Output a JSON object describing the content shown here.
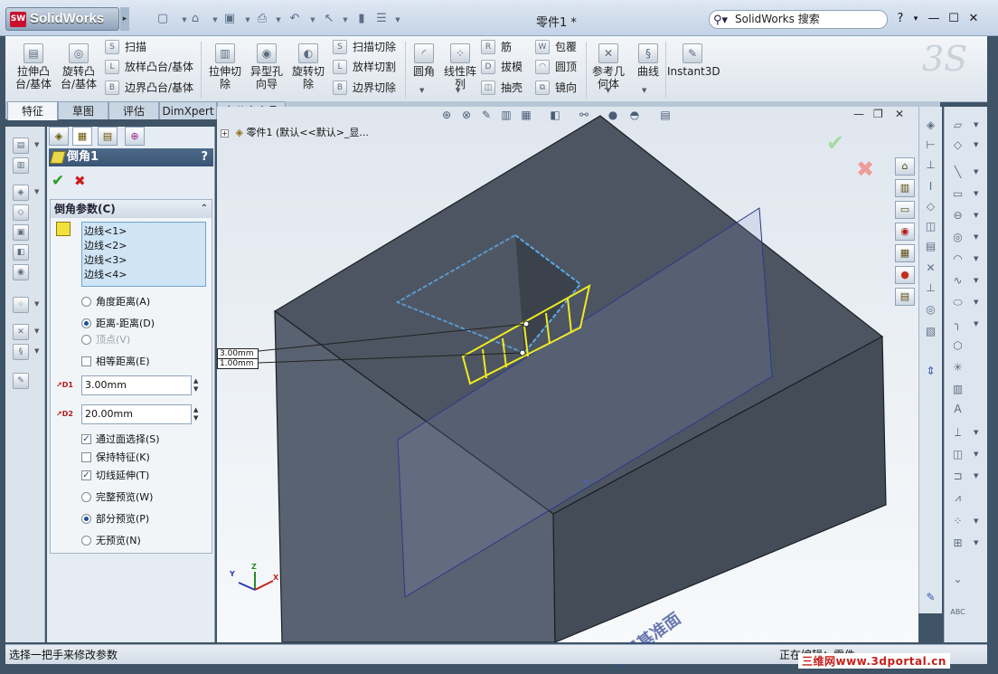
{
  "app": {
    "name": "SolidWorks",
    "logo_badge": "SW",
    "document_title": "零件1 *"
  },
  "search": {
    "placeholder": "SolidWorks 搜索"
  },
  "window_controls": {
    "help": "?",
    "help_dd": "▾",
    "min": "—",
    "max": "☐",
    "close": "✕"
  },
  "ribbon": {
    "big": [
      {
        "label": "拉伸凸台/基体",
        "icon": "extrude-boss-icon"
      },
      {
        "label": "旋转凸台/基体",
        "icon": "revolve-boss-icon"
      },
      {
        "label": "拉伸切除",
        "icon": "extrude-cut-icon"
      },
      {
        "label": "异型孔向导",
        "icon": "hole-wizard-icon"
      },
      {
        "label": "旋转切除",
        "icon": "revolve-cut-icon"
      },
      {
        "label": "圆角",
        "icon": "fillet-icon"
      },
      {
        "label": "线性阵列",
        "icon": "linear-pattern-icon"
      },
      {
        "label": "参考几何体",
        "icon": "reference-geometry-icon"
      },
      {
        "label": "曲线",
        "icon": "curves-icon"
      },
      {
        "label": "Instant3D",
        "icon": "instant3d-icon"
      }
    ],
    "small": {
      "sweep": "扫描",
      "loft": "放样凸台/基体",
      "boundary": "边界凸台/基体",
      "swept_cut": "扫描切除",
      "lofted_cut": "放样切割",
      "boundary_cut": "边界切除",
      "rib": "筋",
      "draft": "拔模",
      "shell": "抽壳",
      "wrap": "包覆",
      "dome": "圆顶",
      "mirror": "镜向"
    }
  },
  "tabs": [
    "特征",
    "草图",
    "评估",
    "DimXpert",
    "办公室产品"
  ],
  "property_manager": {
    "title": "倒角1",
    "help": "?",
    "ok": "✔",
    "cancel": "✖",
    "group_title": "倒角参数(C)",
    "collapse": "⌃",
    "edges": [
      "边线<1>",
      "边线<2>",
      "边线<3>",
      "边线<4>"
    ],
    "options": [
      {
        "label": "角度距离(A)",
        "selected": false,
        "disabled": false
      },
      {
        "label": "距离-距离(D)",
        "selected": true,
        "disabled": false
      },
      {
        "label": "顶点(V)",
        "selected": false,
        "disabled": true
      }
    ],
    "equal_distance": {
      "label": "相等距离(E)",
      "checked": false
    },
    "d1": {
      "tag": "D1",
      "value": "3.00mm"
    },
    "d2": {
      "tag": "D2",
      "value": "20.00mm"
    },
    "checks": [
      {
        "label": "通过面选择(S)",
        "checked": true
      },
      {
        "label": "保持特征(K)",
        "checked": false
      },
      {
        "label": "切线延伸(T)",
        "checked": true
      }
    ],
    "preview": [
      {
        "label": "完整预览(W)",
        "selected": false
      },
      {
        "label": "部分预览(P)",
        "selected": true
      },
      {
        "label": "无预览(N)",
        "selected": false
      }
    ]
  },
  "viewport": {
    "tree_label": "零件1  (默认<<默认>_显...",
    "tree_expand": "+",
    "plane_label": "上视基准面",
    "dim1": "3.00mm",
    "dim2": "1.00mm",
    "accept": "✔",
    "reject": "✖",
    "win_min": "—",
    "win_restore": "❐",
    "win_close": "✕",
    "axes": {
      "x": "X",
      "y": "Y",
      "z": "Z"
    }
  },
  "status": {
    "left": "选择一把手来修改参数",
    "right": "正在编辑：零件",
    "watermark": "三维网www.3dportal.cn"
  }
}
